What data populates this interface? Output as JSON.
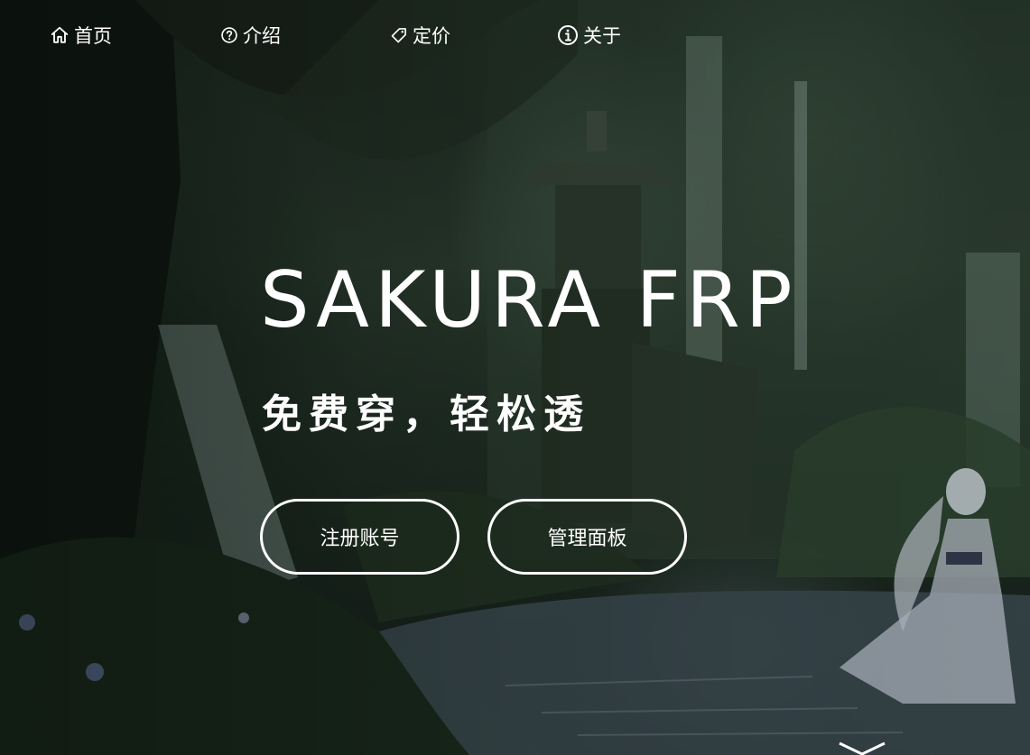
{
  "nav": {
    "items": [
      {
        "label": "首页",
        "icon": "home-icon"
      },
      {
        "label": "介绍",
        "icon": "question-circle-icon"
      },
      {
        "label": "定价",
        "icon": "tag-icon"
      },
      {
        "label": "关于",
        "icon": "info-circle-icon"
      }
    ]
  },
  "hero": {
    "title": "SAKURA FRP",
    "subtitle": "免费穿，轻松透",
    "buttons": {
      "register": "注册账号",
      "panel": "管理面板"
    }
  },
  "scroll_indicator": {
    "icon": "chevron-down-icon"
  },
  "colors": {
    "text": "#ffffff",
    "button_border": "#ffffff"
  }
}
